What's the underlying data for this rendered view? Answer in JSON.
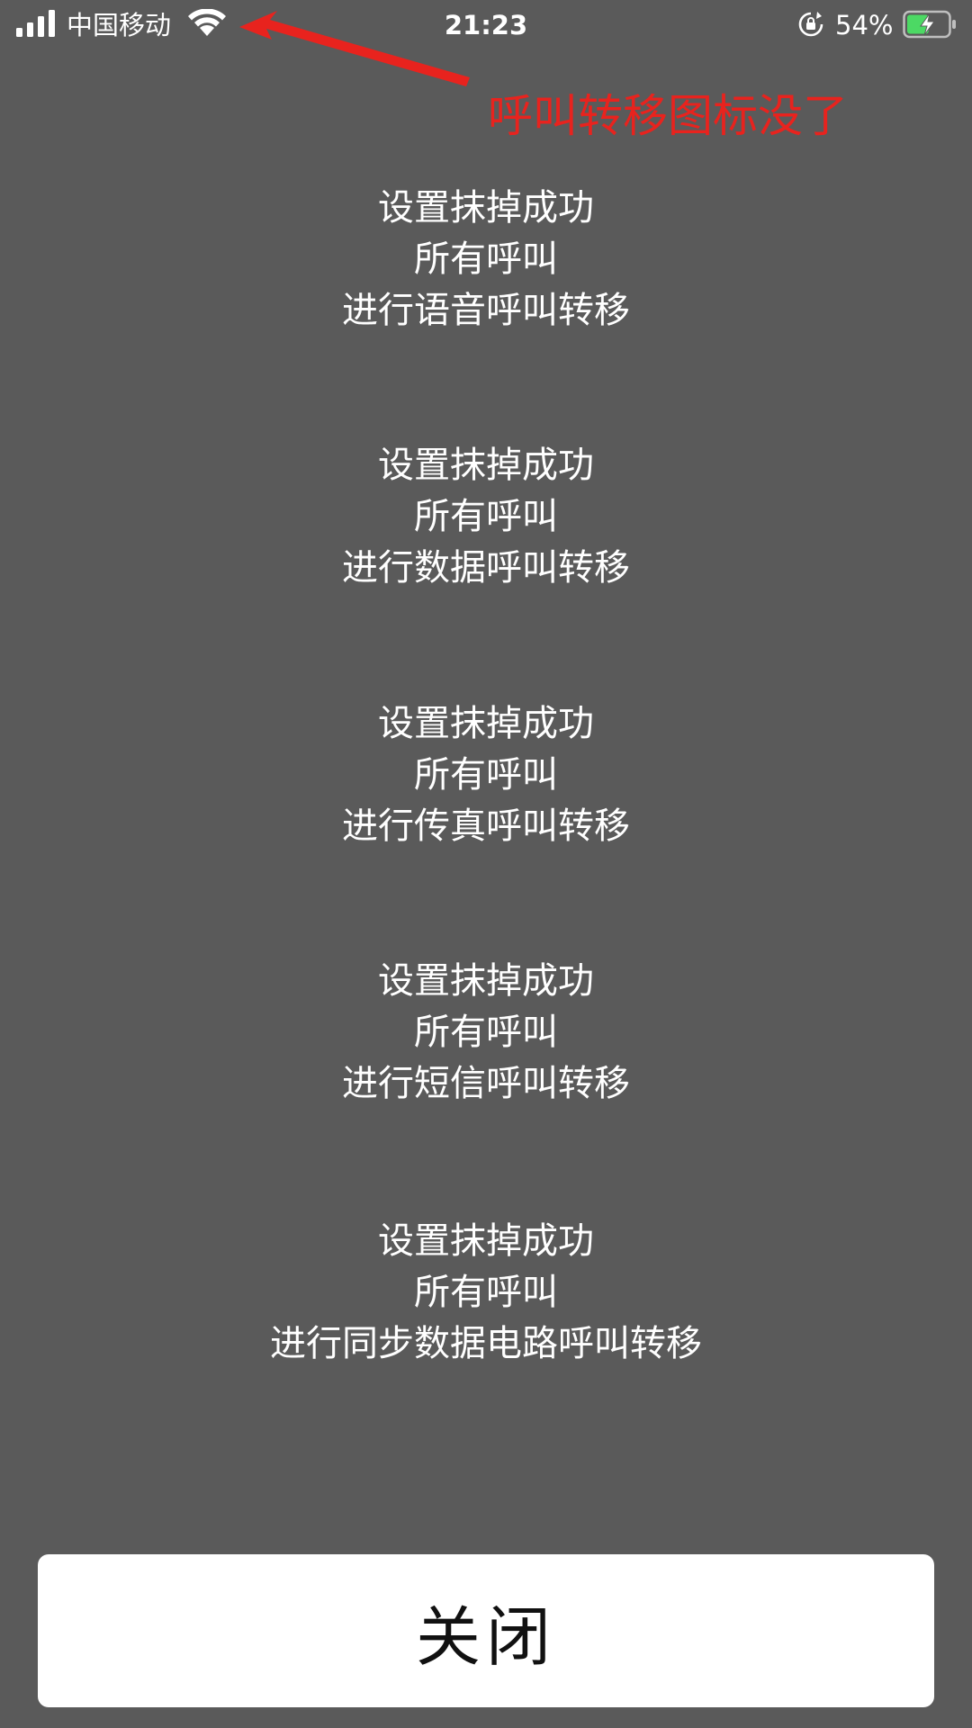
{
  "status_bar": {
    "carrier": "中国移动",
    "time": "21:23",
    "battery_percent": "54%",
    "signal_icon": "signal-bars-icon",
    "wifi_icon": "wifi-icon",
    "rotation_lock_icon": "rotation-lock-icon",
    "battery_icon": "battery-charging-icon",
    "battery_level": 0.54,
    "battery_color": "#4cd964"
  },
  "annotation": {
    "text": "呼叫转移图标没了",
    "color": "#e8231e",
    "arrow_icon": "red-arrow-icon"
  },
  "messages": [
    {
      "line1": "设置抹掉成功",
      "line2": "所有呼叫",
      "line3": "进行语音呼叫转移"
    },
    {
      "line1": "设置抹掉成功",
      "line2": "所有呼叫",
      "line3": "进行数据呼叫转移"
    },
    {
      "line1": "设置抹掉成功",
      "line2": "所有呼叫",
      "line3": "进行传真呼叫转移"
    },
    {
      "line1": "设置抹掉成功",
      "line2": "所有呼叫",
      "line3": "进行短信呼叫转移"
    },
    {
      "line1": "设置抹掉成功",
      "line2": "所有呼叫",
      "line3": "进行同步数据电路呼叫转移"
    }
  ],
  "close_button": {
    "label": "关闭"
  },
  "colors": {
    "background": "#5a5a5a",
    "text": "#ffffff",
    "button_background": "#ffffff",
    "button_text": "#111111"
  }
}
